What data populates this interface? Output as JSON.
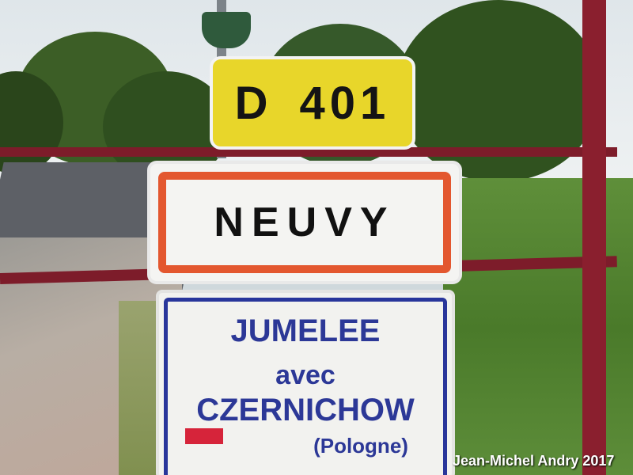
{
  "signs": {
    "road_number": {
      "letter": "D",
      "number": "401"
    },
    "town": {
      "name": "NEUVY"
    },
    "twinning": {
      "line1": "JUMELEE",
      "line2": "avec",
      "line3": "CZERNICHOW",
      "line4": "(Pologne)"
    }
  },
  "credit": "Jean-Michel Andry 2017",
  "colors": {
    "road_sign_yellow": "#e8d62a",
    "town_sign_border": "#e3572f",
    "twin_text_blue": "#2c3897",
    "railing_red": "#7d1c2a"
  }
}
